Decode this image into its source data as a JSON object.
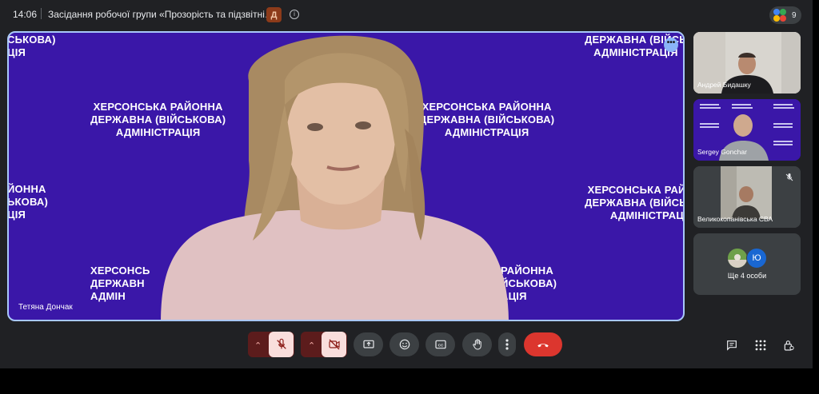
{
  "topbar": {
    "time": "14:06",
    "meeting_title": "Засідання робочої групи «Прозорість та підзвітні…",
    "app_badge": "Д",
    "participant_count": "9"
  },
  "main_tile": {
    "speaker_name": "Тетяна Дончак",
    "background_text": {
      "top_left": [
        "ДЕРЖАВНА (ВІЙСЬКОВА)",
        "ЦІЯ"
      ],
      "top_left_partial": "СЬКОВА)",
      "top_right": [
        "ДЕРЖАВНА (ВІЙСЬ",
        "АДМІНІСТРАЦІЯ"
      ],
      "center_left": [
        "ХЕРСОНСЬКА РАЙОННА",
        "ДЕРЖАВНА (ВІЙСЬКОВА)",
        "АДМІНІСТРАЦІЯ"
      ],
      "center_right": [
        "ХЕРСОНСЬКА РАЙОННА",
        "ДЕРЖАВНА (ВІЙСЬКОВА)",
        "АДМІНІСТРАЦІЯ"
      ],
      "mid_left": [
        "ЙОННА",
        "ЬКОВА)",
        "ЦІЯ"
      ],
      "mid_right": [
        "ХЕРСОНСЬКА РАЙОННА",
        "ДЕРЖАВНА (ВІЙСЬКОВА)",
        "АДМІНІСТРАЦІЯ"
      ],
      "bottom_left": [
        "ХЕРСОНСЬ",
        "ДЕРЖАВН",
        "АДМІН"
      ],
      "bottom_right": [
        "РАЙОННА",
        "ЙСЬКОВА)",
        "АЦІЯ"
      ]
    }
  },
  "side_tiles": [
    {
      "name": "Андрей Бидашку"
    },
    {
      "name": "Sergey Gonchar"
    },
    {
      "name": "Великокопанівська СВА"
    },
    {
      "name": "Ще 4 особи",
      "avatar_letter": "Ю"
    }
  ],
  "colors": {
    "background": "#202124",
    "tile_bg": "#3a17a8",
    "active_border": "#a8c7fa",
    "end_call": "#dc362e",
    "muted_tile": "#f9dedc"
  },
  "toolbar_icons": [
    "chevron-up-icon",
    "mic-off-icon",
    "chevron-up-icon",
    "camera-off-icon",
    "present-icon",
    "emoji-icon",
    "captions-icon",
    "raise-hand-icon",
    "more-vert-icon",
    "end-call-icon"
  ],
  "right_icons": [
    "chat-icon",
    "activities-icon",
    "host-controls-icon"
  ]
}
